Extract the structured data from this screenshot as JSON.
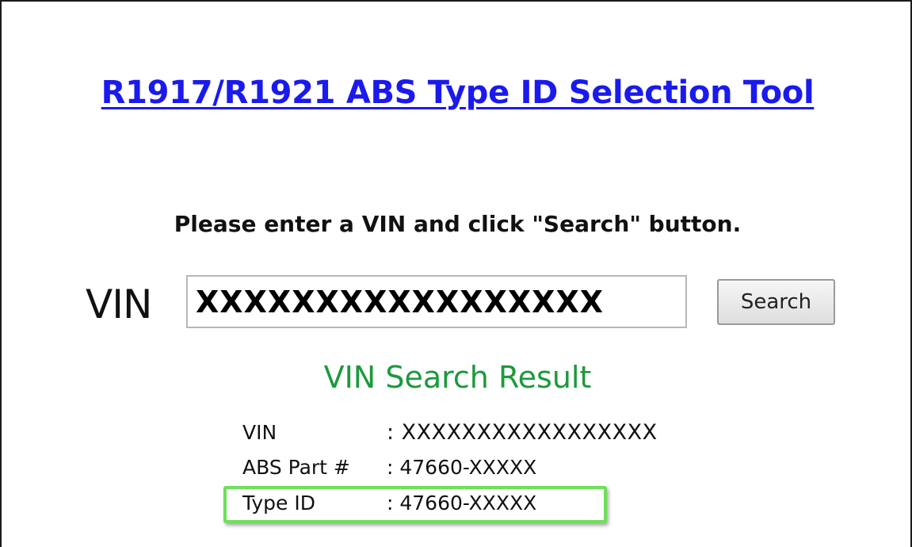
{
  "page": {
    "title": "R1917/R1921 ABS Type ID Selection Tool",
    "instruction": "Please enter a VIN and click \"Search\" button."
  },
  "search": {
    "vin_label": "VIN",
    "vin_value": "XXXXXXXXXXXXXXXXX",
    "button_label": "Search"
  },
  "result": {
    "title": "VIN Search Result",
    "rows": [
      {
        "key": "VIN",
        "value": ": XXXXXXXXXXXXXXXXX"
      },
      {
        "key": "ABS Part #",
        "value": ": 47660-XXXXX"
      },
      {
        "key": "Type ID",
        "value": ": 47660-XXXXX"
      }
    ],
    "highlighted_row": "Type ID",
    "highlight_color": "#6ee05a"
  },
  "colors": {
    "title_link": "#1a1aee",
    "result_title": "#1c9a3c"
  }
}
